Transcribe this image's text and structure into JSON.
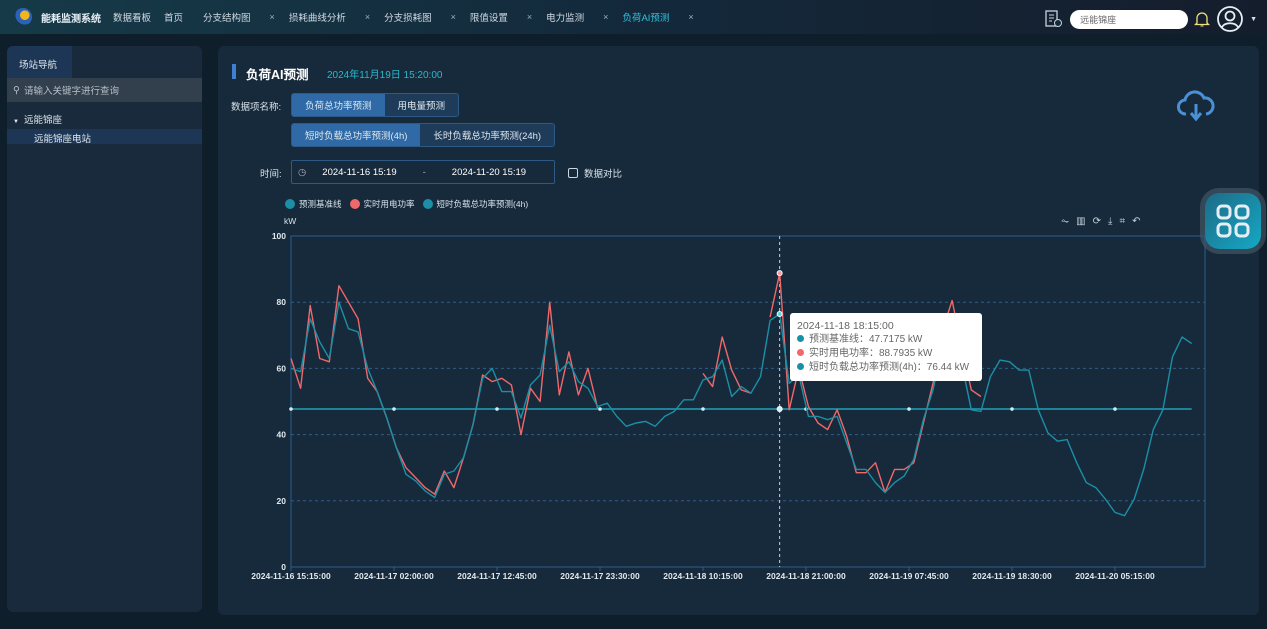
{
  "topbar": {
    "brand": "能耗监测系统",
    "nav": [
      "数据看板",
      "首页"
    ],
    "tabs": [
      {
        "label": "分支结构图"
      },
      {
        "label": "损耗曲线分析"
      },
      {
        "label": "分支损耗图"
      },
      {
        "label": "限值设置"
      },
      {
        "label": "电力监测"
      },
      {
        "label": "负荷AI预测",
        "active": true
      }
    ],
    "close": "×",
    "search_value": "远能锦座"
  },
  "sidebar": {
    "tab": "场站导航",
    "search_placeholder": "请输入关键字进行查询",
    "tree": {
      "root": "远能锦座",
      "child": "远能锦座电站"
    }
  },
  "main": {
    "title": "负荷AI预测",
    "datetime": "2024年11月19日 15:20:00",
    "data_item_label": "数据项名称:",
    "types": [
      "负荷总功率预测",
      "用电量预测"
    ],
    "modes": [
      "短时负载总功率预测(4h)",
      "长时负载总功率预测(24h)"
    ],
    "time_label": "时间:",
    "range_start": "2024-11-16 15:19",
    "range_sep": "-",
    "range_end": "2024-11-20 15:19",
    "compare_label": "数据对比"
  },
  "colors": {
    "baseline": "#23a0b4",
    "actual": "#f0686a",
    "forecast": "#1b8fa6",
    "accent": "#2ab8cc"
  },
  "tooltip": {
    "time": "2024-11-18 18:15:00",
    "rows": [
      "预测基准线：47.7175 kW",
      "实时用电功率：88.7935 kW",
      "短时负载总功率预测(4h)：76.44 kW"
    ]
  },
  "chart_data": {
    "type": "line",
    "ylabel": "kW",
    "ylim": [
      0,
      100
    ],
    "yticks": [
      "0",
      "20",
      "40",
      "60",
      "80",
      "100"
    ],
    "grid": true,
    "legend_position": "top-left",
    "xticks": [
      "2024-11-16 15:15:00",
      "2024-11-17 02:00:00",
      "2024-11-17 12:45:00",
      "2024-11-17 23:30:00",
      "2024-11-18 10:15:00",
      "2024-11-18 21:00:00",
      "2024-11-19 07:45:00",
      "2024-11-19 18:30:00",
      "2024-11-20 05:15:00"
    ],
    "x": [
      "2024-11-16 15:15",
      "16:15",
      "17:15",
      "18:15",
      "19:15",
      "20:15",
      "21:15",
      "22:15",
      "23:15",
      "2024-11-17 00:15",
      "01:15",
      "02:15",
      "03:15",
      "04:15",
      "05:15",
      "06:15",
      "07:15",
      "08:15",
      "09:15",
      "10:15",
      "11:15",
      "12:15",
      "13:15",
      "14:15",
      "15:15",
      "16:15",
      "17:15",
      "18:15",
      "19:15",
      "20:15",
      "21:15",
      "22:15",
      "23:15",
      "2024-11-18 00:15",
      "01:15",
      "02:15",
      "03:15",
      "04:15",
      "05:15",
      "06:15",
      "07:15",
      "08:15",
      "09:15",
      "10:15",
      "11:15",
      "12:15",
      "13:15",
      "14:15",
      "15:15",
      "16:15",
      "17:15",
      "18:15",
      "19:15",
      "20:15",
      "21:15",
      "22:15",
      "23:15",
      "2024-11-19 00:15",
      "01:15",
      "02:15",
      "03:15",
      "04:15",
      "05:15",
      "06:15",
      "07:15",
      "08:15",
      "09:15",
      "10:15",
      "11:15",
      "12:15",
      "13:15",
      "14:15",
      "15:15",
      "16:15",
      "17:15",
      "18:15",
      "19:15",
      "20:15",
      "21:15",
      "22:15",
      "23:15",
      "2024-11-20 00:15",
      "01:15",
      "02:15",
      "03:15",
      "04:15",
      "05:15",
      "06:15",
      "07:15",
      "08:15",
      "09:15",
      "10:15",
      "11:15",
      "12:15",
      "13:15"
    ],
    "series": [
      {
        "name": "预测基准线",
        "constant": 47.7175
      },
      {
        "name": "实时用电功率",
        "values": [
          63,
          54,
          79,
          63,
          62,
          85,
          80,
          75,
          57,
          53,
          45,
          36,
          30,
          27,
          24,
          22,
          29,
          24,
          33,
          43,
          58,
          56,
          57,
          55,
          40,
          54,
          50,
          80,
          52,
          65,
          52,
          60,
          48,
          null,
          null,
          null,
          null,
          null,
          null,
          null,
          null,
          null,
          null,
          58.5,
          54.5,
          69.5,
          59.5,
          53.5,
          52.5,
          null,
          75.5,
          88.79,
          47.5,
          60,
          48.5,
          43.5,
          41.5,
          47.5,
          39.5,
          28.5,
          28.5,
          31.5,
          22.5,
          29.5,
          29.5,
          31.5,
          43.5,
          55.5,
          71.5,
          80.5,
          66.6,
          53.5,
          51.5,
          null,
          null,
          null,
          null,
          null,
          null,
          null,
          null,
          null,
          null,
          null,
          null,
          null,
          null,
          null,
          null,
          null,
          null,
          null,
          null,
          null
        ]
      },
      {
        "name": "短时负载总功率预测(4h)",
        "values": [
          60,
          59,
          75,
          68,
          63,
          80,
          72,
          71,
          60,
          53,
          45,
          36,
          28,
          26,
          23,
          21,
          28,
          29,
          33,
          43,
          57,
          60,
          53,
          53,
          45,
          55,
          58,
          73,
          59,
          62,
          56,
          54,
          48.5,
          49.5,
          45.5,
          42.5,
          43.5,
          44,
          42.5,
          45.5,
          47,
          50.5,
          50.5,
          56.5,
          57.5,
          62.5,
          51.5,
          54.5,
          52.5,
          57.5,
          74.5,
          76.44,
          55.5,
          58,
          45.5,
          45.5,
          44.5,
          45.5,
          37.5,
          29.5,
          29.5,
          25.5,
          22.5,
          25.5,
          27.5,
          32.5,
          44.5,
          53.5,
          66.5,
          61.5,
          61.5,
          47.5,
          47,
          57.5,
          62.5,
          62,
          59.5,
          59.5,
          47.5,
          40.5,
          38,
          38.5,
          31.5,
          25.5,
          24,
          20.5,
          16.5,
          15.5,
          20.5,
          29.5,
          41.5,
          47.5,
          63.5,
          69.5,
          67.5
        ]
      }
    ]
  }
}
